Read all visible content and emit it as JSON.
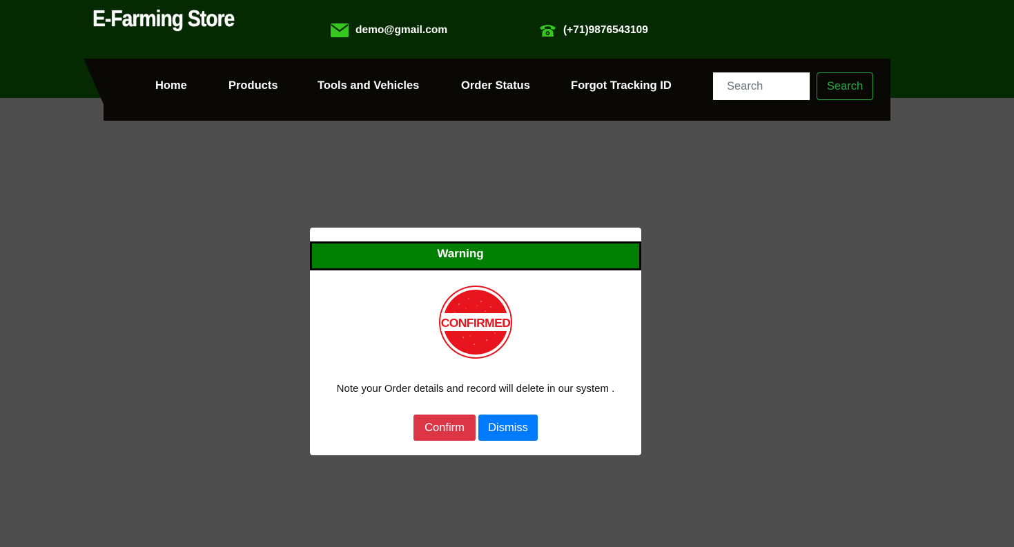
{
  "header": {
    "brand": "E-Farming Store",
    "email": "demo@gmail.com",
    "phone": "(+71)9876543109",
    "email_icon": "envelope-icon",
    "phone_icon": "telephone-icon"
  },
  "nav": {
    "items": [
      {
        "label": "Home"
      },
      {
        "label": "Products"
      },
      {
        "label": "Tools and Vehicles"
      },
      {
        "label": "Order Status"
      },
      {
        "label": "Forgot Tracking ID"
      }
    ],
    "search_placeholder": "Search",
    "search_button": "Search"
  },
  "modal": {
    "title": "Warning",
    "stamp_text": "CONFIRMED",
    "message": "Note your Order details and record will delete in our system .",
    "confirm_label": "Confirm",
    "dismiss_label": "Dismiss"
  },
  "colors": {
    "header_bg": "#052a02",
    "nav_bg": "#0a0805",
    "accent_green": "#28a745",
    "modal_header": "#008000",
    "confirm": "#dc3545",
    "dismiss": "#007bff",
    "overlay": "#4e4e4e"
  }
}
